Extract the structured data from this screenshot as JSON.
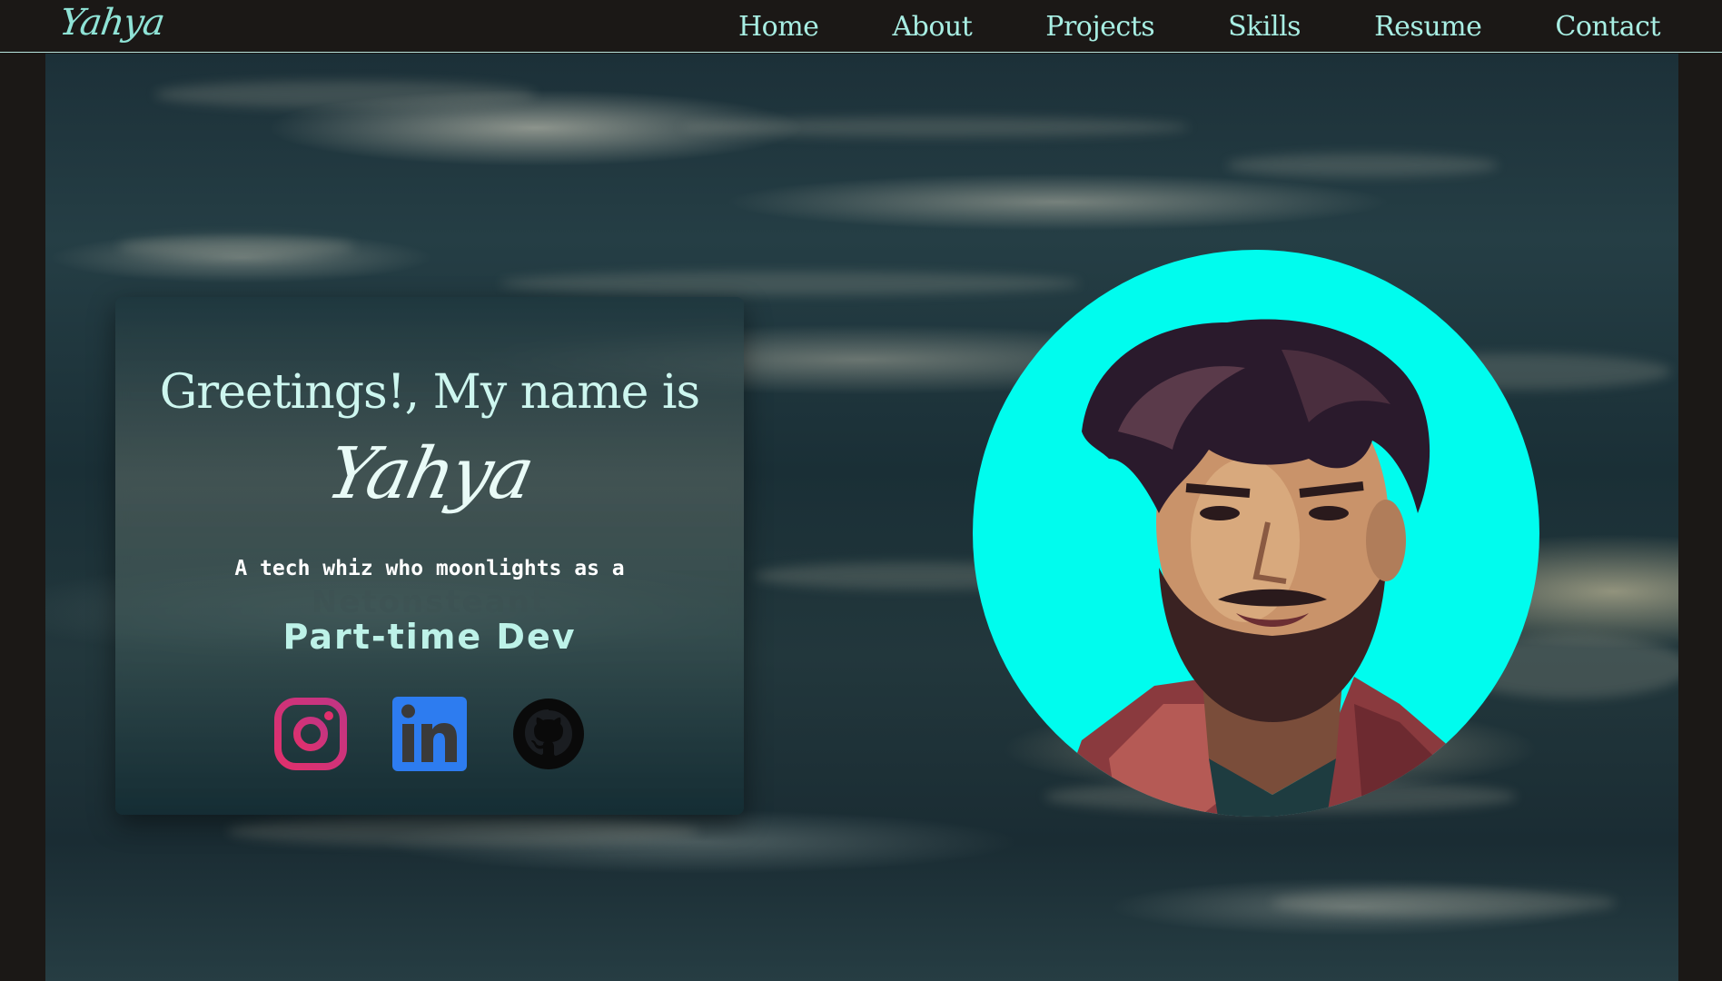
{
  "navbar": {
    "logo": "Yahya",
    "links": [
      "Home",
      "About",
      "Projects",
      "Skills",
      "Resume",
      "Contact"
    ]
  },
  "hero": {
    "greeting": "Greetings!, My name is",
    "name": "Yahya",
    "tagline": "A tech whiz who moonlights as a",
    "role_ghost": "Netonsteant",
    "role": "Part-time Dev"
  },
  "socials": [
    {
      "icon": "instagram-icon"
    },
    {
      "icon": "linkedin-icon"
    },
    {
      "icon": "github-icon"
    }
  ],
  "colors": {
    "nav_bg": "#1b1816",
    "nav_text": "#a8eee3",
    "avatar_bg": "#00fcee",
    "instagram": "#e1306c",
    "linkedin": "#2d7cf0",
    "github": "#0a0a0a"
  }
}
